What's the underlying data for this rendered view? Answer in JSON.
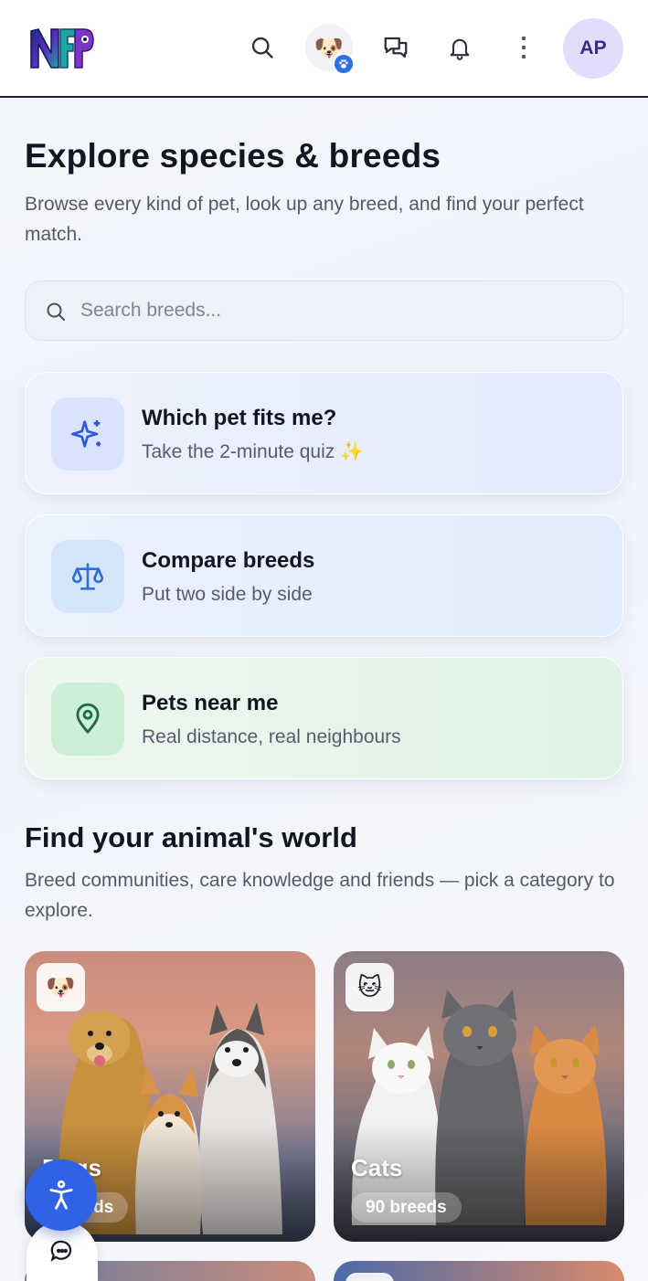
{
  "header": {
    "logo_text": "NFP",
    "avatar_initials": "AP",
    "pet_switch_emoji": "🐶",
    "icons": [
      "search-icon",
      "pet-switch-button",
      "chat-icon",
      "bell-icon",
      "more-vertical-icon"
    ]
  },
  "intro": {
    "title": "Explore species & breeds",
    "subtitle": "Browse every kind of pet, look up any breed, and find your perfect match."
  },
  "search": {
    "placeholder": "Search breeds...",
    "value": ""
  },
  "actions": [
    {
      "title": "Which pet fits me?",
      "subtitle": "Take the 2-minute quiz",
      "emoji": "✨",
      "icon": "sparkles-icon"
    },
    {
      "title": "Compare breeds",
      "subtitle": "Put two side by side",
      "icon": "scale-icon"
    },
    {
      "title": "Pets near me",
      "subtitle": "Real distance, real neighbours",
      "icon": "map-pin-icon"
    }
  ],
  "section": {
    "title": "Find your animal's world",
    "subtitle": "Breed communities, care knowledge and friends — pick a category to explore."
  },
  "categories": [
    {
      "name": "Dogs",
      "emoji": "🐶",
      "count_label": "breeds"
    },
    {
      "name": "Cats",
      "emoji": "🐱",
      "count_label": "90 breeds"
    }
  ],
  "colors": {
    "accent": "#2f62e6",
    "avatar_bg": "#e4dcfb",
    "quiz_card": "#e3ebfd",
    "compare_card": "#e1edfc",
    "near_card": "#dff3e6"
  }
}
